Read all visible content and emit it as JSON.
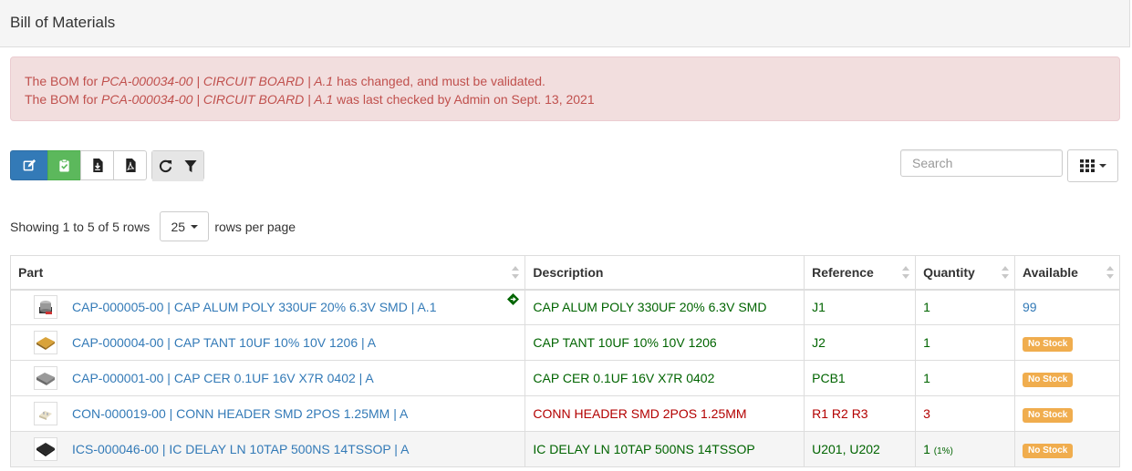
{
  "page": {
    "title": "Bill of Materials"
  },
  "alert": {
    "line1_prefix": "The BOM for ",
    "line1_part": "PCA-000034-00 | CIRCUIT BOARD | A.1",
    "line1_suffix": " has changed, and must be validated.",
    "line2_prefix": "The BOM for ",
    "line2_part": "PCA-000034-00 | CIRCUIT BOARD | A.1",
    "line2_suffix": " was last checked by Admin on Sept. 13, 2021"
  },
  "toolbar": {
    "icons": [
      "edit-icon",
      "clipboard-check-icon",
      "download-icon",
      "pdf-icon",
      "refresh-icon",
      "filter-icon"
    ]
  },
  "search": {
    "placeholder": "Search"
  },
  "pagination": {
    "showing_text": "Showing 1 to 5 of 5 rows",
    "page_size": "25",
    "rows_per_page_label": "rows per page"
  },
  "table": {
    "headers": [
      "Part",
      "Description",
      "Reference",
      "Quantity",
      "Available"
    ],
    "rows": [
      {
        "part": "CAP-000005-00 | CAP ALUM POLY 330UF 20% 6.3V SMD | A.1",
        "description": "CAP ALUM POLY 330UF 20% 6.3V SMD",
        "reference": "J1",
        "quantity": "1",
        "quantity_note": "",
        "available": "99"
      },
      {
        "part": "CAP-000004-00 | CAP TANT 10UF 10% 10V 1206 | A",
        "description": "CAP TANT 10UF 10% 10V 1206",
        "reference": "J2",
        "quantity": "1",
        "quantity_note": "",
        "available": "No Stock"
      },
      {
        "part": "CAP-000001-00 | CAP CER 0.1UF 16V X7R 0402 | A",
        "description": "CAP CER 0.1UF 16V X7R 0402",
        "reference": "PCB1",
        "quantity": "1",
        "quantity_note": "",
        "available": "No Stock"
      },
      {
        "part": "CON-000019-00 | CONN HEADER SMD 2POS 1.25MM | A",
        "description": "CONN HEADER SMD 2POS 1.25MM",
        "reference": "R1 R2 R3",
        "quantity": "3",
        "quantity_note": "",
        "available": "No Stock"
      },
      {
        "part": "ICS-000046-00 | IC DELAY LN 10TAP 500NS 14TSSOP | A",
        "description": "IC DELAY LN 10TAP 500NS 14TSSOP",
        "reference": "U201, U202",
        "quantity": "1",
        "quantity_note": "(1%)",
        "available": "No Stock"
      }
    ]
  },
  "colors": {
    "primary": "#337ab7",
    "success": "#5cb85c",
    "warning": "#f0ad4e",
    "danger_text": "#c0504d",
    "ok_text": "#006400",
    "error_text": "#b30000"
  }
}
